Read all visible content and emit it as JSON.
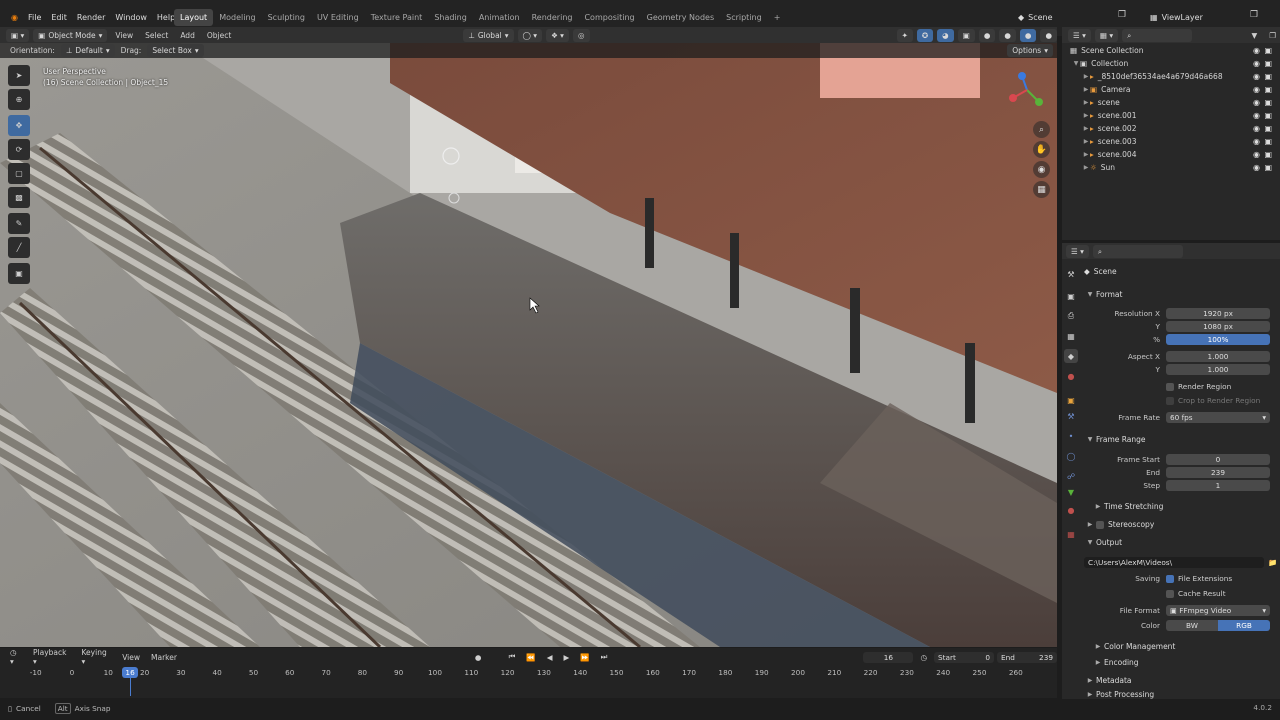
{
  "menu": [
    "File",
    "Edit",
    "Render",
    "Window",
    "Help"
  ],
  "workspaces": [
    "Layout",
    "Modeling",
    "Sculpting",
    "UV Editing",
    "Texture Paint",
    "Shading",
    "Animation",
    "Rendering",
    "Compositing",
    "Geometry Nodes",
    "Scripting"
  ],
  "active_workspace": "Layout",
  "scene_name": "Scene",
  "view_layer": "ViewLayer",
  "viewport_header": {
    "mode": "Object Mode",
    "menus": [
      "View",
      "Select",
      "Add",
      "Object"
    ],
    "orientation_global": "Global",
    "orientation_label": "Orientation:",
    "orientation_value": "Default",
    "drag_label": "Drag:",
    "drag_value": "Select Box",
    "options": "Options"
  },
  "viewport_info": {
    "line1": "User Perspective",
    "line2": "(16) Scene Collection | Object_15"
  },
  "outliner": {
    "root": "Scene Collection",
    "collection": "Collection",
    "items": [
      "_8510def36534ae4a679d46a668",
      "Camera",
      "scene",
      "scene.001",
      "scene.002",
      "scene.003",
      "scene.004",
      "Sun"
    ]
  },
  "properties": {
    "context": "Scene",
    "format_title": "Format",
    "res_x_label": "Resolution X",
    "res_x": "1920 px",
    "res_y_label": "Y",
    "res_y": "1080 px",
    "pct_label": "%",
    "pct": "100%",
    "aspect_x_label": "Aspect X",
    "aspect_x": "1.000",
    "aspect_y_label": "Y",
    "aspect_y": "1.000",
    "render_region": "Render Region",
    "crop_region": "Crop to Render Region",
    "frame_rate_label": "Frame Rate",
    "frame_rate": "60 fps",
    "frame_range_title": "Frame Range",
    "frame_start_label": "Frame Start",
    "frame_start": "0",
    "end_label": "End",
    "end": "239",
    "step_label": "Step",
    "step": "1",
    "time_stretching": "Time Stretching",
    "stereoscopy": "Stereoscopy",
    "output_title": "Output",
    "output_path": "C:\\Users\\AlexM\\Videos\\",
    "saving_label": "Saving",
    "file_extensions": "File Extensions",
    "cache_result": "Cache Result",
    "file_format_label": "File Format",
    "file_format": "FFmpeg Video",
    "color_label": "Color",
    "color_bw": "BW",
    "color_rgb": "RGB",
    "color_management": "Color Management",
    "encoding": "Encoding",
    "metadata": "Metadata",
    "post_processing": "Post Processing"
  },
  "timeline": {
    "menus": [
      "Playback",
      "Keying",
      "View",
      "Marker"
    ],
    "current_frame": "16",
    "start_label": "Start",
    "start": "0",
    "end_label": "End",
    "end": "239",
    "ticks": [
      "-10",
      "0",
      "10",
      "20",
      "30",
      "40",
      "50",
      "60",
      "70",
      "80",
      "90",
      "100",
      "110",
      "120",
      "130",
      "140",
      "150",
      "160",
      "170",
      "180",
      "190",
      "200",
      "210",
      "220",
      "230",
      "240",
      "250",
      "260"
    ],
    "playhead": "16"
  },
  "status": {
    "cancel": "Cancel",
    "alt_key": "Alt",
    "axis_snap": "Axis Snap",
    "version": "4.0.2"
  },
  "colors": {
    "accent": "#4673b7",
    "playhead": "#4a7ccf",
    "bg": "#1d1d1d",
    "panel": "#282828"
  }
}
